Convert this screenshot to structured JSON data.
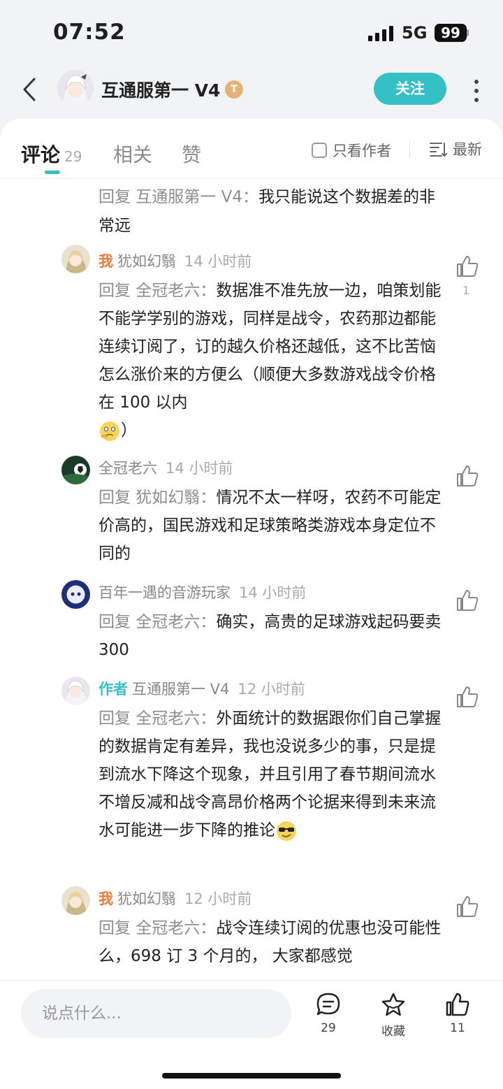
{
  "status": {
    "time": "07:52",
    "network": "5G",
    "battery": "99"
  },
  "header": {
    "title": "互通服第一 V4",
    "level_badge": "T",
    "follow_label": "关注"
  },
  "tabs": {
    "comments_label": "评论",
    "comments_count": "29",
    "related_label": "相关",
    "likes_label": "赞",
    "author_only_label": "只看作者",
    "sort_label": "最新"
  },
  "top_reply": {
    "prefix": "回复 互通服第一 V4：",
    "text": "我只能说这个数据差的非常远"
  },
  "replies": [
    {
      "tag": "我",
      "name": "犹如幻翳",
      "time": "14 小时前",
      "prefix": "回复 全冠老六：",
      "text": "数据准不准先放一边，咱策划能不能学学别的游戏，同样是战令，农药那边都能连续订阅了，订的越久价格还越低，这不比苦恼怎么涨价来的方便么（顺便大多数游戏战令价格在 100 以内",
      "tail": "）",
      "likes": "1"
    },
    {
      "tag": "",
      "name": "全冠老六",
      "time": "14 小时前",
      "prefix": "回复 犹如幻翳：",
      "text": "情况不太一样呀，农药不可能定价高的，国民游戏和足球策略类游戏本身定位不同的",
      "likes": ""
    },
    {
      "tag": "",
      "name": "百年一遇的音游玩家",
      "time": "14 小时前",
      "prefix": "回复 全冠老六：",
      "text": "确实，高贵的足球游戏起码要卖 300",
      "likes": ""
    },
    {
      "tag": "作者",
      "name": "互通服第一 V4",
      "time": "12 小时前",
      "prefix": "回复 全冠老六：",
      "text": "外面统计的数据跟你们自己掌握的数据肯定有差异，我也没说多少的事，只是提到流水下降这个现象，并且引用了春节期间流水不增反减和战令高昂价格两个论据来得到未来流水可能进一步下降的推论",
      "likes": ""
    },
    {
      "tag": "我",
      "name": "犹如幻翳",
      "time": "12 小时前",
      "prefix": "回复 全冠老六：",
      "text": "战令连续订阅的优惠也没可能性么，698 订 3 个月的， 大家都感觉",
      "likes": ""
    }
  ],
  "bottom": {
    "input_placeholder": "说点什么...",
    "comment_count": "29",
    "favorite_label": "收藏",
    "like_count": "11"
  }
}
